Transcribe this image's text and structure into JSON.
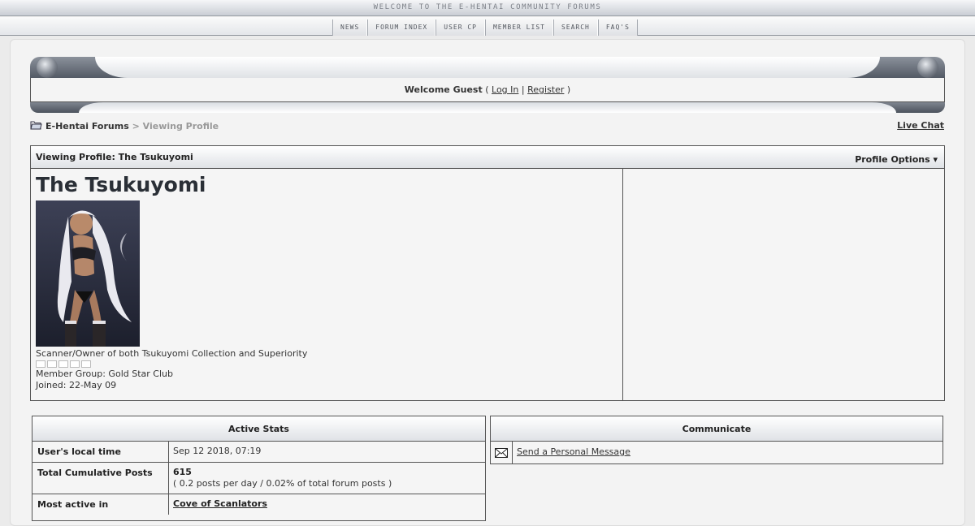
{
  "banner": {
    "text": "Welcome to the E-Hentai Community Forums"
  },
  "nav": {
    "items": [
      "News",
      "Forum Index",
      "User CP",
      "Member List",
      "Search",
      "FAQ's"
    ]
  },
  "welcome": {
    "greeting": "Welcome Guest",
    "open": "(",
    "login": "Log In",
    "sep": "|",
    "register": "Register",
    "close": ")"
  },
  "breadcrumb": {
    "home": "E-Hentai Forums",
    "rest": "> Viewing Profile"
  },
  "livechat": "Live Chat",
  "profile": {
    "title": "Viewing Profile: The Tsukuyomi",
    "options": "Profile Options ▾",
    "username": "The Tsukuyomi",
    "tagline": "Scanner/Owner of both Tsukuyomi Collection and Superiority",
    "group": "Member Group: Gold Star Club",
    "joined": "Joined: 22-May 09"
  },
  "stats": {
    "header": "Active Stats",
    "local_time_label": "User's local time",
    "local_time_value": "Sep 12 2018, 07:19",
    "posts_label": "Total Cumulative Posts",
    "posts_count": "615",
    "posts_detail": "( 0.2 posts per day / 0.02% of total forum posts )",
    "active_label": "Most active in",
    "active_value": "Cove of Scanlators"
  },
  "communicate": {
    "header": "Communicate",
    "pm": "Send a Personal Message"
  }
}
